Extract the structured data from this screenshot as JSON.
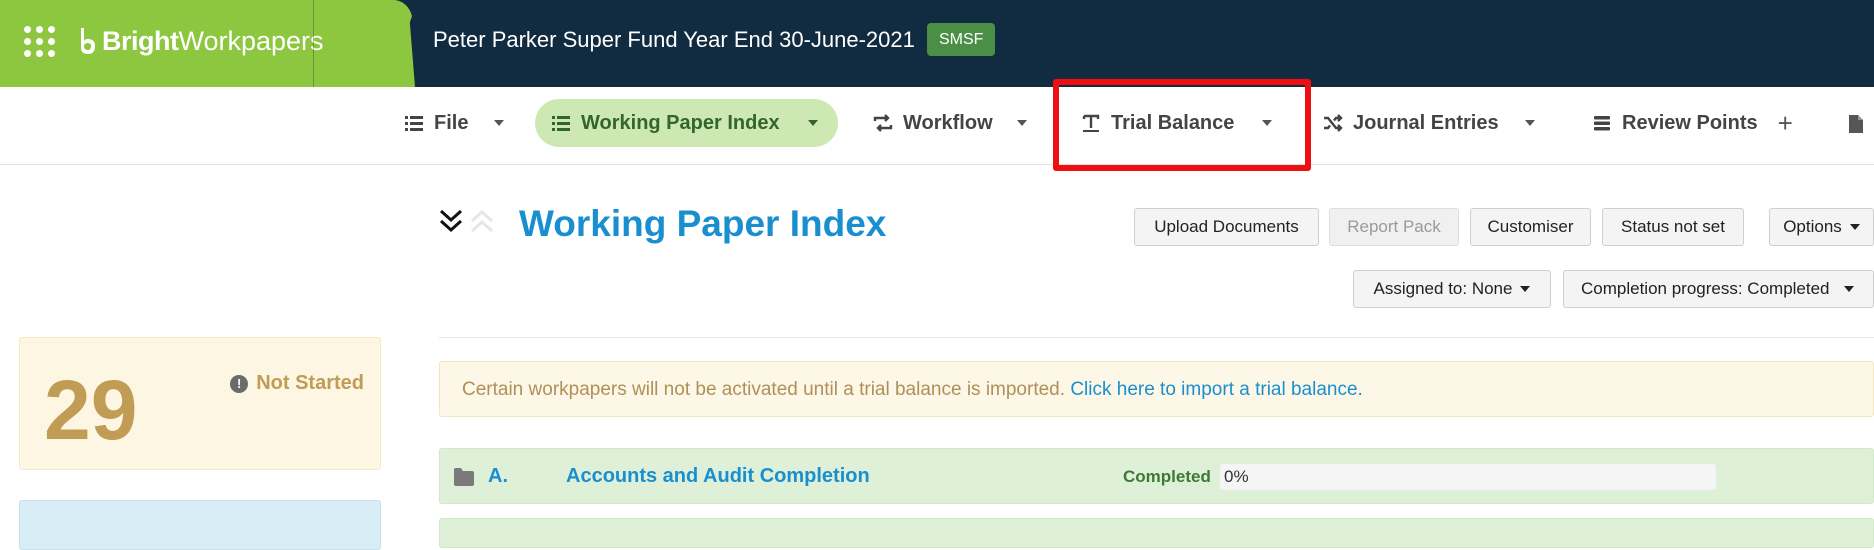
{
  "app": {
    "brand_bold": "Bright",
    "brand_light": "Workpapers",
    "fund_title": "Peter Parker Super Fund Year End 30-June-2021",
    "fund_badge": "SMSF",
    "colors": {
      "topbar": "#112b40",
      "brand_green": "#8dc63f",
      "accent_blue": "#1a8fd0",
      "highlight": "#ee0f12"
    }
  },
  "nav": {
    "items": [
      {
        "label": "File",
        "icon": "list-icon"
      },
      {
        "label": "Working Paper Index",
        "icon": "list-icon",
        "active": true
      },
      {
        "label": "Workflow",
        "icon": "loop-icon"
      },
      {
        "label": "Trial Balance",
        "icon": "text-t-icon",
        "highlighted": true
      },
      {
        "label": "Journal Entries",
        "icon": "shuffle-icon"
      },
      {
        "label": "Review Points",
        "icon": "stack-icon"
      }
    ]
  },
  "stat": {
    "count": "29",
    "label": "Not Started"
  },
  "main": {
    "title": "Working Paper Index",
    "buttons": {
      "upload": "Upload Documents",
      "report_pack": "Report Pack",
      "customiser": "Customiser",
      "status": "Status not set",
      "options": "Options"
    },
    "filters": {
      "assigned": "Assigned to: None",
      "completion": "Completion progress: Completed"
    },
    "alert": {
      "text": "Certain workpapers will not be activated until a trial balance is imported.",
      "link": "Click here to import a trial balance."
    },
    "sections": [
      {
        "code": "A.",
        "name": "Accounts and Audit Completion",
        "status": "Completed",
        "progress": "0%"
      }
    ]
  }
}
